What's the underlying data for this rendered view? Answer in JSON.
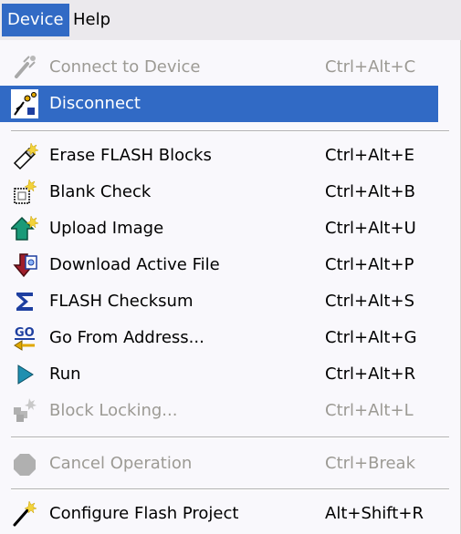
{
  "menubar": {
    "items": [
      {
        "label": "Device"
      },
      {
        "label": "Help"
      }
    ]
  },
  "menu": {
    "items": [
      {
        "label": "Connect to Device",
        "shortcut": "Ctrl+Alt+C",
        "icon": "plug-connect-icon",
        "enabled": false
      },
      {
        "label": "Disconnect",
        "shortcut": "",
        "icon": "plug-disconnect-icon",
        "enabled": true,
        "highlighted": true
      },
      {
        "label": "Erase FLASH Blocks",
        "shortcut": "Ctrl+Alt+E",
        "icon": "eraser-icon",
        "enabled": true
      },
      {
        "label": "Blank Check",
        "shortcut": "Ctrl+Alt+B",
        "icon": "blank-check-icon",
        "enabled": true
      },
      {
        "label": "Upload Image",
        "shortcut": "Ctrl+Alt+U",
        "icon": "upload-icon",
        "enabled": true
      },
      {
        "label": "Download Active File",
        "shortcut": "Ctrl+Alt+P",
        "icon": "download-icon",
        "enabled": true
      },
      {
        "label": "FLASH Checksum",
        "shortcut": "Ctrl+Alt+S",
        "icon": "sigma-icon",
        "enabled": true
      },
      {
        "label": "Go From Address...",
        "shortcut": "Ctrl+Alt+G",
        "icon": "go-icon",
        "enabled": true
      },
      {
        "label": "Run",
        "shortcut": "Ctrl+Alt+R",
        "icon": "run-icon",
        "enabled": true
      },
      {
        "label": "Block Locking...",
        "shortcut": "Ctrl+Alt+L",
        "icon": "block-locking-icon",
        "enabled": false
      },
      {
        "label": "Cancel Operation",
        "shortcut": "Ctrl+Break",
        "icon": "stop-icon",
        "enabled": false
      },
      {
        "label": "Configure Flash Project",
        "shortcut": "Alt+Shift+R",
        "icon": "configure-icon",
        "enabled": true
      }
    ]
  },
  "colors": {
    "highlight": "#316ac5",
    "disabled_text": "#9c9a94",
    "menu_bg": "#f9f8fc",
    "menubar_bg": "#ebe9ed"
  }
}
